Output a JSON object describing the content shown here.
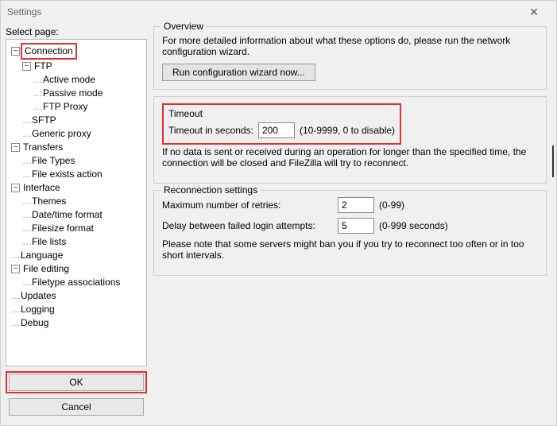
{
  "window": {
    "title": "Settings",
    "close_glyph": "✕"
  },
  "left": {
    "label": "Select page:",
    "ok": "OK",
    "cancel": "Cancel"
  },
  "tree": {
    "connection": "Connection",
    "ftp": "FTP",
    "active_mode": "Active mode",
    "passive_mode": "Passive mode",
    "ftp_proxy": "FTP Proxy",
    "sftp": "SFTP",
    "generic_proxy": "Generic proxy",
    "transfers": "Transfers",
    "file_types": "File Types",
    "file_exists": "File exists action",
    "interface": "Interface",
    "themes": "Themes",
    "datetime": "Date/time format",
    "filesize": "Filesize format",
    "filelists": "File lists",
    "language": "Language",
    "file_editing": "File editing",
    "filetype_assoc": "Filetype associations",
    "updates": "Updates",
    "logging": "Logging",
    "debug": "Debug"
  },
  "overview": {
    "title": "Overview",
    "text": "For more detailed information about what these options do, please run the network configuration wizard.",
    "button": "Run configuration wizard now..."
  },
  "timeout": {
    "title": "Timeout",
    "label": "Timeout in seconds:",
    "value": "200",
    "hint": "(10-9999, 0 to disable)",
    "note": "If no data is sent or received during an operation for longer than the specified time, the connection will be closed and FileZilla will try to reconnect."
  },
  "reconnect": {
    "title": "Reconnection settings",
    "retries_label": "Maximum number of retries:",
    "retries_value": "2",
    "retries_hint": "(0-99)",
    "delay_label": "Delay between failed login attempts:",
    "delay_value": "5",
    "delay_hint": "(0-999 seconds)",
    "note": "Please note that some servers might ban you if you try to reconnect too often or in too short intervals."
  }
}
